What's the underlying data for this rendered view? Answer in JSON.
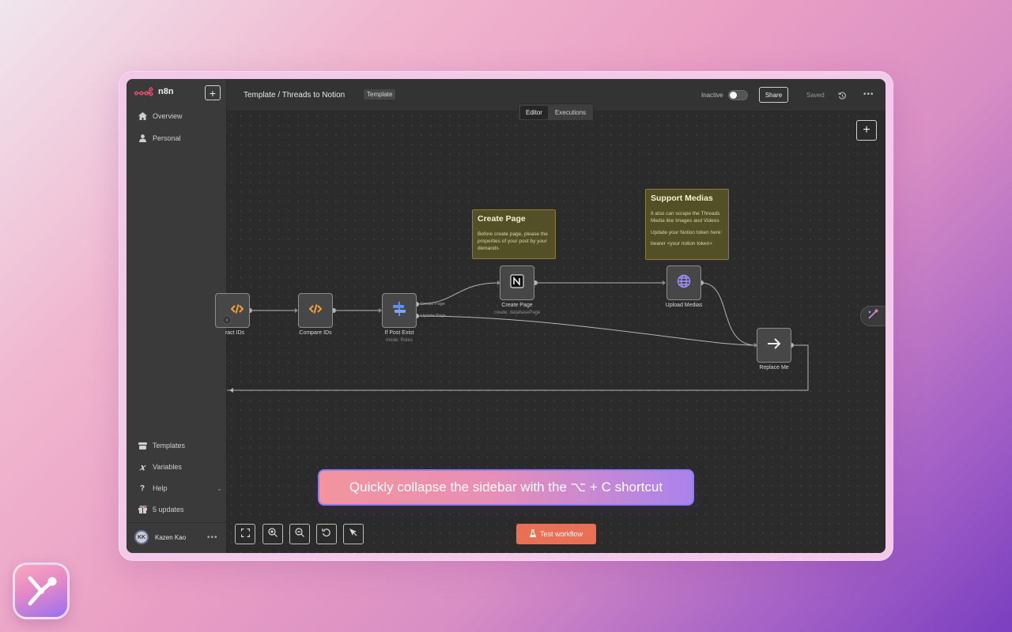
{
  "app": {
    "logo_text": "n8n",
    "workflow_title": "Template / Threads to Notion",
    "template_badge": "Template"
  },
  "sidebar": {
    "add_label": "+",
    "items": [
      {
        "label": "Overview",
        "icon": "home-icon"
      },
      {
        "label": "Personal",
        "icon": "user-icon"
      }
    ],
    "bottom_items": [
      {
        "label": "Templates",
        "icon": "templates-icon"
      },
      {
        "label": "Variables",
        "icon": "variables-icon"
      },
      {
        "label": "Help",
        "icon": "help-icon"
      },
      {
        "label": "5 updates",
        "icon": "gift-icon"
      }
    ],
    "user": {
      "initials": "KK",
      "name": "Kazen Kao"
    }
  },
  "topbar": {
    "status_label": "Inactive",
    "share_label": "Share",
    "saved_label": "Saved"
  },
  "tabs": [
    {
      "label": "Editor",
      "active": true
    },
    {
      "label": "Executions",
      "active": false
    }
  ],
  "canvas": {
    "add_label": "+",
    "nodes": {
      "extract_ids": {
        "label": "ract IDs"
      },
      "compare_ids": {
        "label": "Compare IDs"
      },
      "if_post_exist": {
        "label": "If Post Exist",
        "sub": "mode: Rules"
      },
      "create_page": {
        "label": "Create Page",
        "sub": "create: databasePage"
      },
      "upload_medias": {
        "label": "Upload Medias"
      },
      "replace_me": {
        "label": "Replace Me"
      }
    },
    "port_labels": {
      "create_page": "Create Page",
      "update_page": "Update Page"
    },
    "stickies": {
      "create_page": {
        "title": "Create Page",
        "body": "Before create page, please the properties of your post by your demands"
      },
      "support_medias": {
        "title": "Support Medias",
        "line1": "It also can scrape the Threads Media like Images and Videos",
        "line2": "Update your Notion token here:",
        "line3": "bearer <your notion token>"
      }
    },
    "test_button": "Test workflow"
  },
  "tooltip": {
    "text": "Quickly collapse the sidebar with the ⌥ + C shortcut"
  },
  "colors": {
    "accent": "#e96f55",
    "node_code": "#f0a23a",
    "node_if": "#5c8ff0",
    "node_http": "#9f90ff",
    "sticky_bg": "#534f26"
  }
}
